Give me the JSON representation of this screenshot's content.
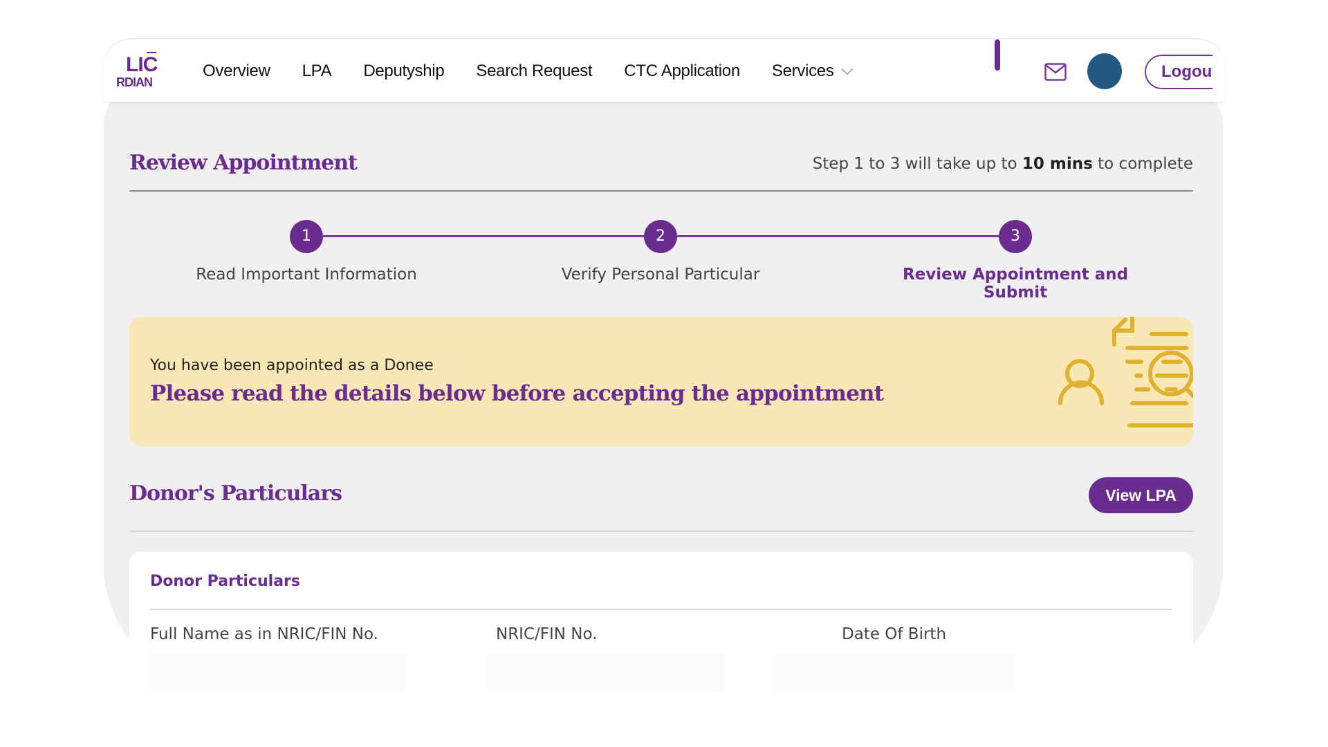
{
  "brand": {
    "logo_line1": "LIC",
    "logo_line2": "RDIAN",
    "accent_color": "#6b2c8f",
    "avatar_color": "#245880",
    "banner_color": "#f9e8b5",
    "illustration_color": "#e0b12f"
  },
  "navbar": {
    "items": [
      {
        "label": "Overview"
      },
      {
        "label": "LPA"
      },
      {
        "label": "Deputyship"
      },
      {
        "label": "Search Request"
      },
      {
        "label": "CTC Application"
      },
      {
        "label": "Services",
        "has_dropdown": true
      }
    ],
    "mail_icon": "mail-icon",
    "logout_label": "Logout"
  },
  "page": {
    "title": "Review Appointment",
    "time_note_prefix": "Step 1 to 3 will take up to ",
    "time_note_bold": "10 mins",
    "time_note_suffix": " to complete"
  },
  "stepper": {
    "current_step": 3,
    "steps": [
      {
        "number": "1",
        "label": "Read Important Information"
      },
      {
        "number": "2",
        "label": "Verify Personal Particular"
      },
      {
        "number": "3",
        "label": "Review Appointment and Submit"
      }
    ]
  },
  "banner": {
    "subtitle": "You have been appointed as a Donee",
    "title": "Please read the details below before accepting the appointment",
    "illustration": "person-document-search-illustration"
  },
  "donor_section": {
    "title": "Donor's Particulars",
    "view_lpa_label": "View LPA",
    "card": {
      "title": "Donor Particulars",
      "fields": [
        {
          "label": "Full Name as in NRIC/FIN No.",
          "value": ""
        },
        {
          "label": "NRIC/FIN No.",
          "value": ""
        },
        {
          "label": "Date Of Birth",
          "value": ""
        }
      ]
    }
  }
}
